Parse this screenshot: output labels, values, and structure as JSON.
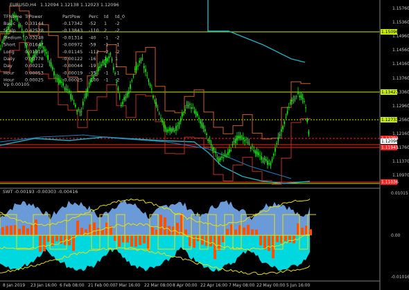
{
  "header": {
    "symbol": "EURUSD,H4",
    "prices": "1.12094 1.12138 1.12023 1.12096"
  },
  "table": {
    "headers": [
      "TFName",
      "TrPower",
      "PartPow",
      "Perc",
      "td",
      "td_0"
    ],
    "rows": [
      [
        "Basic",
        "0.33144",
        "-0.17342",
        "-52",
        "1",
        "-2"
      ],
      [
        "Scalp",
        "0.42528",
        "-0.13843",
        "-110",
        "2",
        "-2"
      ],
      [
        "Medium",
        "0.03248",
        "-0.01314",
        "-40",
        "-1",
        "-2"
      ],
      [
        "Short",
        "0.01647",
        "-0.00972",
        "-59",
        "-1",
        "-1"
      ],
      [
        "Long",
        "0.01018",
        "-0.01145",
        "-112",
        "-2",
        "-2"
      ],
      [
        "Daily",
        "0.00778",
        "-0.00122",
        "-16",
        "1",
        "1"
      ],
      [
        "Day",
        "0.00212",
        "-0.00044",
        "-19",
        "1",
        "1"
      ],
      [
        "Hour",
        "0.00053",
        "-0.00019",
        "-35",
        "-1",
        "-1"
      ],
      [
        "Hour",
        "0.00025",
        "-0.00025",
        "-100",
        "-1",
        "-2"
      ]
    ],
    "footer": "Vp 0.00105"
  },
  "price_axis": {
    "ticks": [
      "1.15760",
      "1.15360",
      "1.14960",
      "1.14560",
      "1.14160",
      "1.13760",
      "1.13360",
      "1.12960",
      "1.12560",
      "1.12160",
      "1.11760",
      "1.11370",
      "1.10970"
    ],
    "labels": [
      {
        "text": "1.15096",
        "bg": "#c8f000",
        "fg": "#000000"
      },
      {
        "text": "1.13427",
        "bg": "#c8f000",
        "fg": "#000000"
      },
      {
        "text": "1.12733",
        "bg": "#c8f000",
        "fg": "#000000"
      },
      {
        "text": "1.12294",
        "bg": "#ff2020",
        "fg": "#ffffff"
      },
      {
        "text": "1.12096",
        "bg": "#ffffff",
        "fg": "#000000"
      },
      {
        "text": "1.11945",
        "bg": "#ff2020",
        "fg": "#ffffff"
      },
      {
        "text": "1.11036",
        "bg": "#ff2020",
        "fg": "#ffffff"
      }
    ]
  },
  "sub": {
    "title": "SWT -0.00193 -0.00303 -0.00416",
    "ticks": [
      "0.01015",
      "0.00",
      "-0.01016"
    ]
  },
  "time_axis": [
    "8 Jan 2019",
    "23 Jan 16:00",
    "6 Feb 08:00",
    "21 Feb 00:00",
    "7 Mar 16:00",
    "22 Mar 08:00",
    "8 Apr 00:00",
    "22 Apr 16:00",
    "7 May 08:00",
    "22 May 00:00",
    "5 Jun 16:00"
  ],
  "colors": {
    "background": "#000000",
    "candles": "#00ff00",
    "level_lines": "#c8f000",
    "red_lines": "#ff2020",
    "ma_cyan": "#20b0c0",
    "orange_area": "#ff5000",
    "blue_area": "#6a9ad8",
    "cyan_area": "#00d8e0",
    "yellow_lines": "#e8e000"
  }
}
